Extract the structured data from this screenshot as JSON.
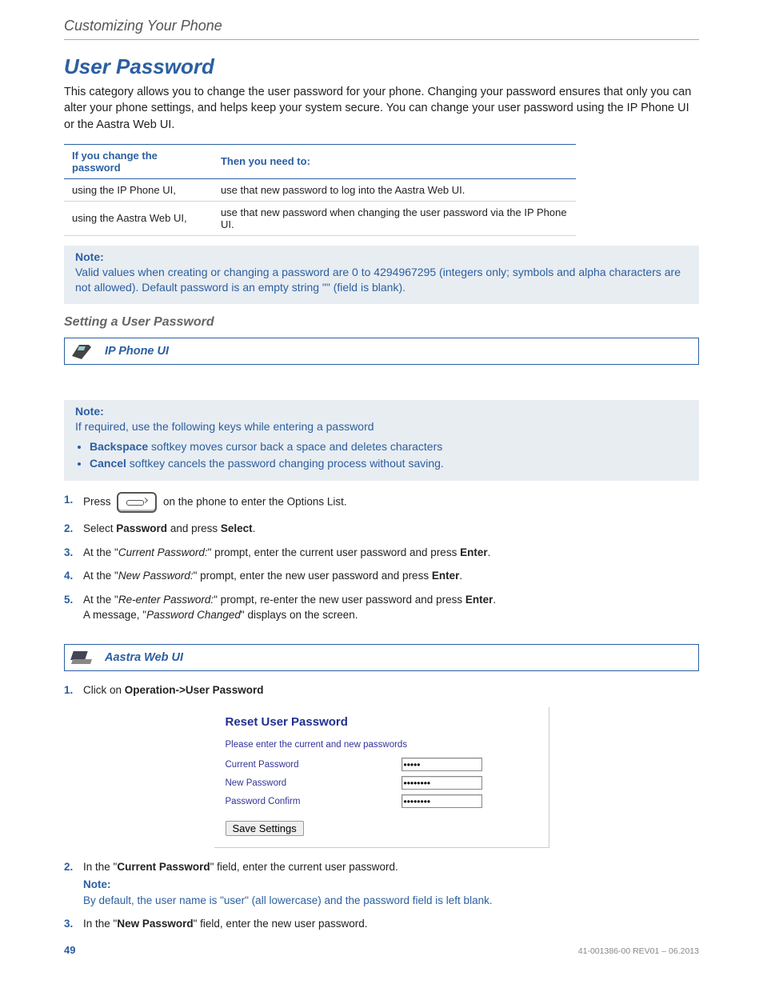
{
  "breadcrumb": "Customizing Your Phone",
  "heading": "User Password",
  "intro": "This category allows you to change the user password for your phone. Changing your password ensures that only you can alter your phone settings, and helps keep your system secure. You can change your user password using the IP Phone UI or the Aastra Web UI.",
  "table": {
    "headers": [
      "If you change the password",
      "Then you need to:"
    ],
    "rows": [
      [
        "using the IP Phone UI,",
        "use that new password to log into the Aastra Web UI."
      ],
      [
        "using the Aastra Web UI,",
        "use that new password when changing the user password via the IP Phone UI."
      ]
    ]
  },
  "note1": {
    "title": "Note:",
    "text": "Valid values when creating or changing a password are 0 to 4294967295 (integers only; symbols and alpha characters are not allowed). Default password is an empty string \"\" (field is blank)."
  },
  "sub_heading": "Setting a User Password",
  "ip_phone_ui_label": "IP Phone UI",
  "note2": {
    "title": "Note:",
    "intro": "If required, use the following keys while entering a password",
    "bullets": [
      {
        "b": "Backspace",
        "t": " softkey moves cursor back a space and deletes characters"
      },
      {
        "b": "Cancel",
        "t": " softkey cancels the password changing process without saving."
      }
    ]
  },
  "steps_ip": [
    {
      "n": "1.",
      "pre": "Press ",
      "post": " on the phone to enter the Options List.",
      "key": true
    },
    {
      "n": "2.",
      "html": "Select <b>Password</b> and press <b>Select</b>."
    },
    {
      "n": "3.",
      "html": "At the \"<i>Current Password:</i>\" prompt, enter the current user password and press <b>Enter</b>."
    },
    {
      "n": "4.",
      "html": "At the \"<i>New Password:</i>\" prompt, enter the new user password and press <b>Enter</b>."
    },
    {
      "n": "5.",
      "html": "At the \"<i>Re-enter Password:</i>\" prompt, re-enter the new user password and press <b>Enter</b>.<br>A message, \"<i>Password Changed</i>\" displays on the screen."
    }
  ],
  "aastra_web_ui_label": "Aastra Web UI",
  "steps_web_pre": {
    "n": "1.",
    "html": "Click on <b>Operation->User Password</b>"
  },
  "screenshot": {
    "title": "Reset User Password",
    "sub": "Please enter the current and new passwords",
    "fields": [
      {
        "label": "Current Password",
        "value": "•••••"
      },
      {
        "label": "New Password",
        "value": "••••••••"
      },
      {
        "label": "Password Confirm",
        "value": "••••••••"
      }
    ],
    "button": "Save Settings"
  },
  "steps_web_post": [
    {
      "n": "2.",
      "html": "In the \"<b>Current Password</b>\" field, enter the current user password.",
      "note_title": "Note:",
      "note_text": "By default, the user name is \"user\" (all lowercase) and the password field is left blank."
    },
    {
      "n": "3.",
      "html": "In the \"<b>New Password</b>\" field, enter the new user password."
    }
  ],
  "footer": {
    "page": "49",
    "id": "41-001386-00 REV01 – 06.2013"
  }
}
